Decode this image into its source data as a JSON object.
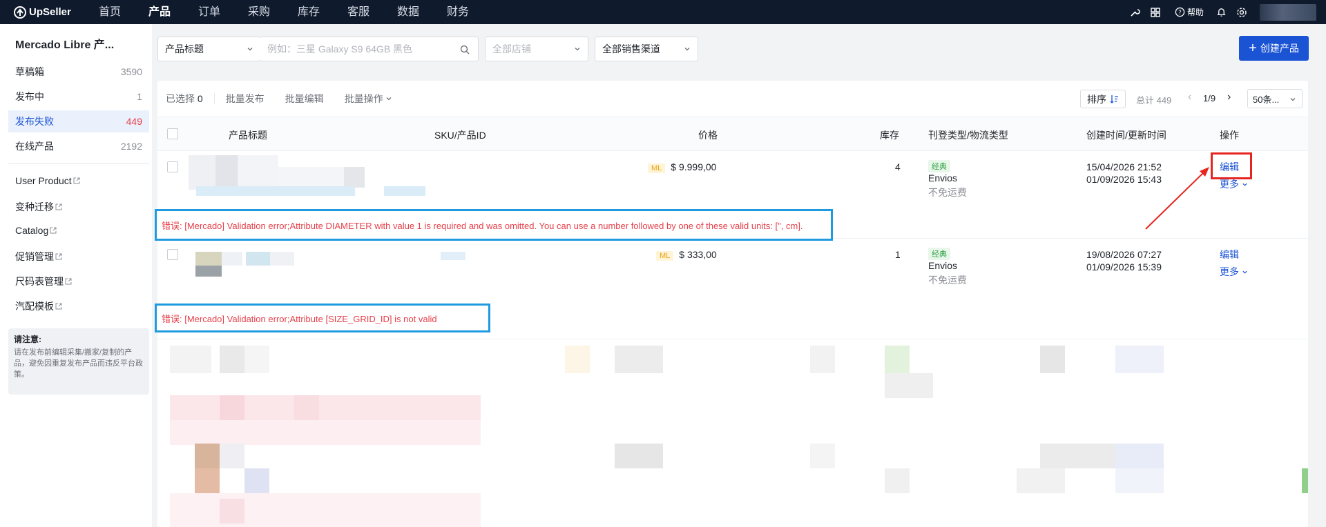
{
  "topnav": {
    "brand": "UpSeller",
    "items": [
      "首页",
      "产品",
      "订单",
      "采购",
      "库存",
      "客服",
      "数据",
      "财务"
    ],
    "active_index": 1,
    "help_label": "帮助"
  },
  "sidebar": {
    "title": "Mercado Libre 产...",
    "counted_items": [
      {
        "label": "草稿箱",
        "count": "3590"
      },
      {
        "label": "发布中",
        "count": "1"
      },
      {
        "label": "发布失败",
        "count": "449"
      },
      {
        "label": "在线产品",
        "count": "2192"
      }
    ],
    "active_index": 2,
    "links": [
      "User Product",
      "变种迁移",
      "Catalog",
      "促销管理",
      "尺码表管理",
      "汽配模板"
    ],
    "notice_title": "请注意:",
    "notice_text": "请在发布前编辑采集/搬家/复制的产品，避免因重复发布产品而违反平台政策。"
  },
  "filters": {
    "field_select": "产品标题",
    "search_placeholder": "例如：三星 Galaxy S9 64GB 黑色",
    "shop_select": "全部店铺",
    "channel_select": "全部销售渠道",
    "create_label": "创建产品"
  },
  "toolbar": {
    "selected_label": "已选择",
    "selected_count": "0",
    "batch_publish": "批量发布",
    "batch_edit": "批量编辑",
    "batch_ops": "批量操作",
    "sort_label": "排序",
    "total_label": "总计 449",
    "page": "1/9",
    "page_size": "50条..."
  },
  "table": {
    "headers": [
      "产品标题",
      "SKU/产品ID",
      "价格",
      "库存",
      "刊登类型/物流类型",
      "创建时间/更新时间",
      "操作"
    ],
    "rows": [
      {
        "ml_tag": "ML",
        "price": "$ 9.999,00",
        "stock": "4",
        "listing_tag": "经典",
        "logistics": "Envios",
        "shipping": "不免运费",
        "created": "15/04/2026 21:52",
        "updated": "01/09/2026 15:43",
        "edit": "编辑",
        "more": "更多",
        "error": "错误: [Mercado] Validation error;Attribute DIAMETER with value 1 is required and was omitted. You can use a number followed by one of these valid units: [\", cm]."
      },
      {
        "ml_tag": "ML",
        "price": "$ 333,00",
        "stock": "1",
        "listing_tag": "经典",
        "logistics": "Envios",
        "shipping": "不免运费",
        "created": "19/08/2026 07:27",
        "updated": "01/09/2026 15:39",
        "edit": "编辑",
        "more": "更多",
        "error": "错误: [Mercado] Validation error;Attribute [SIZE_GRID_ID] is not valid"
      }
    ]
  },
  "colors": {
    "topnav_bg": "#0f1b2d",
    "primary": "#1a53d4",
    "error_text": "#e5404a",
    "highlight_blue": "#1e9be0",
    "highlight_red": "#e5251e"
  }
}
